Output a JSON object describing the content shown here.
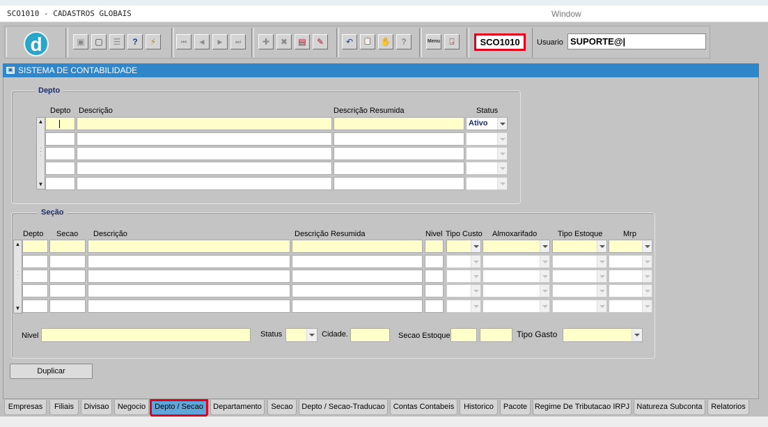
{
  "window": {
    "app_title": "SCO1010 - CADASTROS GLOBAIS",
    "menu_window": "Window"
  },
  "toolbar": {
    "logo": "d",
    "module_code": "SCO1010",
    "usuario_label": "Usuario",
    "usuario_value": "SUPORTE@|",
    "buttons": [
      {
        "name": "save-icon",
        "glyph": "▣"
      },
      {
        "name": "screen-icon",
        "glyph": "▢"
      },
      {
        "name": "print-icon",
        "glyph": "☰"
      },
      {
        "name": "query-help-icon",
        "glyph": "?"
      },
      {
        "name": "execute-query-icon",
        "glyph": "⚡"
      },
      {
        "name": "first-record-icon",
        "glyph": "⏮"
      },
      {
        "name": "previous-record-icon",
        "glyph": "◀"
      },
      {
        "name": "next-record-icon",
        "glyph": "▶"
      },
      {
        "name": "last-record-icon",
        "glyph": "⏭"
      },
      {
        "name": "insert-record-icon",
        "glyph": "✚"
      },
      {
        "name": "delete-record-icon",
        "glyph": "✖"
      },
      {
        "name": "lov-icon",
        "glyph": "▤"
      },
      {
        "name": "edit-icon",
        "glyph": "✎"
      },
      {
        "name": "undo-icon",
        "glyph": "↶"
      },
      {
        "name": "clipboard-icon",
        "glyph": "📋"
      },
      {
        "name": "tools-icon",
        "glyph": "✋"
      },
      {
        "name": "help-icon",
        "glyph": "?"
      },
      {
        "name": "menu-icon",
        "glyph": "Menu"
      },
      {
        "name": "exit-icon",
        "glyph": "⍈"
      }
    ]
  },
  "form": {
    "title": "SISTEMA DE CONTABILIDADE"
  },
  "depto": {
    "title": "Depto",
    "headers": {
      "depto": "Depto",
      "descricao": "Descrição",
      "descricao_resumida": "Descrição Resumida",
      "status": "Status"
    },
    "first_row_status": "Ativo"
  },
  "secao": {
    "title": "Seção",
    "headers": {
      "depto": "Depto",
      "secao": "Secao",
      "descricao": "Descrição",
      "descricao_resumida": "Descrição Resumida",
      "nivel": "Nivel",
      "tipo_custo": "Tipo Custo",
      "almoxarifado": "Almoxarifado",
      "tipo_estoque": "Tipo Estoque",
      "mrp": "Mrp"
    },
    "detail": {
      "nivel_label": "Nivel",
      "status_label": "Status",
      "cidade_label": "Cidade.",
      "secao_estoque_label": "Secao Estoque",
      "tipo_gasto_label": "Tipo Gasto"
    }
  },
  "buttons": {
    "duplicar": "Duplicar"
  },
  "tabs": [
    "Empresas",
    "Filiais",
    "Divisao",
    "Negocio",
    "Depto / Secao",
    "Departamento",
    "Secao",
    "Depto / Secao-Traducao",
    "Contas Contabeis",
    "Historico",
    "Pacote",
    "Regime De Tributacao IRPJ",
    "Natureza Subconta",
    "Relatorios"
  ],
  "active_tab": "Depto / Secao"
}
